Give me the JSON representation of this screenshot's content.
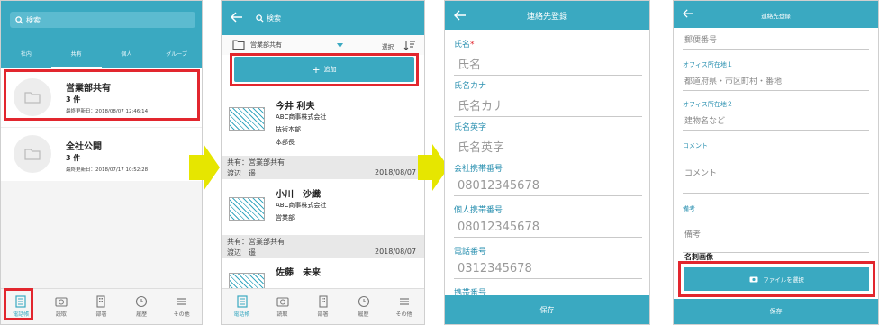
{
  "screen1": {
    "search_placeholder": "検索",
    "tabs": [
      "社内",
      "共有",
      "個人",
      "グループ"
    ],
    "folders": [
      {
        "name": "営業部共有",
        "count": "3 件",
        "updated": "最終更新日：2018/08/07 12:46:14"
      },
      {
        "name": "全社公開",
        "count": "3 件",
        "updated": "最終更新日：2018/07/17 10:52:28"
      }
    ]
  },
  "screen2": {
    "search_placeholder": "検索",
    "folder_name": "営業部共有",
    "select_label": "選択",
    "add_label": "追加",
    "contacts": [
      {
        "name": "今井 利夫",
        "company": "ABC商事株式会社",
        "dept": "技術本部",
        "title": "本部長",
        "share": "共有：営業部共有",
        "owner": "渡辺　遥",
        "date": "2018/08/07"
      },
      {
        "name": "小川　沙織",
        "company": "ABC商事株式会社",
        "dept": "営業部",
        "title": "",
        "share": "共有：営業部共有",
        "owner": "渡辺　遥",
        "date": "2018/08/07"
      },
      {
        "name": "佐藤　未来",
        "company": "",
        "dept": "",
        "title": "",
        "share": "",
        "owner": "",
        "date": ""
      }
    ]
  },
  "tabbar": [
    "電話帳",
    "読取",
    "部署",
    "履歴",
    "その他"
  ],
  "screen3": {
    "title": "連絡先登録",
    "fields": [
      {
        "label": "氏名",
        "required": "*",
        "value": "氏名"
      },
      {
        "label": "氏名カナ",
        "required": "",
        "value": "氏名カナ"
      },
      {
        "label": "氏名英字",
        "required": "",
        "value": "氏名英字"
      },
      {
        "label": "会社携帯番号",
        "required": "",
        "value": "08012345678"
      },
      {
        "label": "個人携帯番号",
        "required": "",
        "value": "08012345678"
      },
      {
        "label": "電話番号",
        "required": "",
        "value": "0312345678"
      },
      {
        "label": "携帯番号",
        "required": "",
        "value": ""
      }
    ],
    "save_label": "保存"
  },
  "screen4": {
    "title": "連絡先登録",
    "top_field": "郵便番号",
    "fields": [
      {
        "label": "オフィス所在地１",
        "value": "都道府県・市区町村・番地"
      },
      {
        "label": "オフィス所在地２",
        "value": "建物名など"
      },
      {
        "label": "コメント",
        "value": "コメント"
      },
      {
        "label": "備考",
        "value": "備考"
      }
    ],
    "card_image_label": "名刺画像",
    "file_button_label": "ファイルを選択",
    "save_label": "保存"
  },
  "colors": {
    "accent": "#3aa9c1",
    "highlight": "#e2262e",
    "arrow": "#e6e600"
  }
}
